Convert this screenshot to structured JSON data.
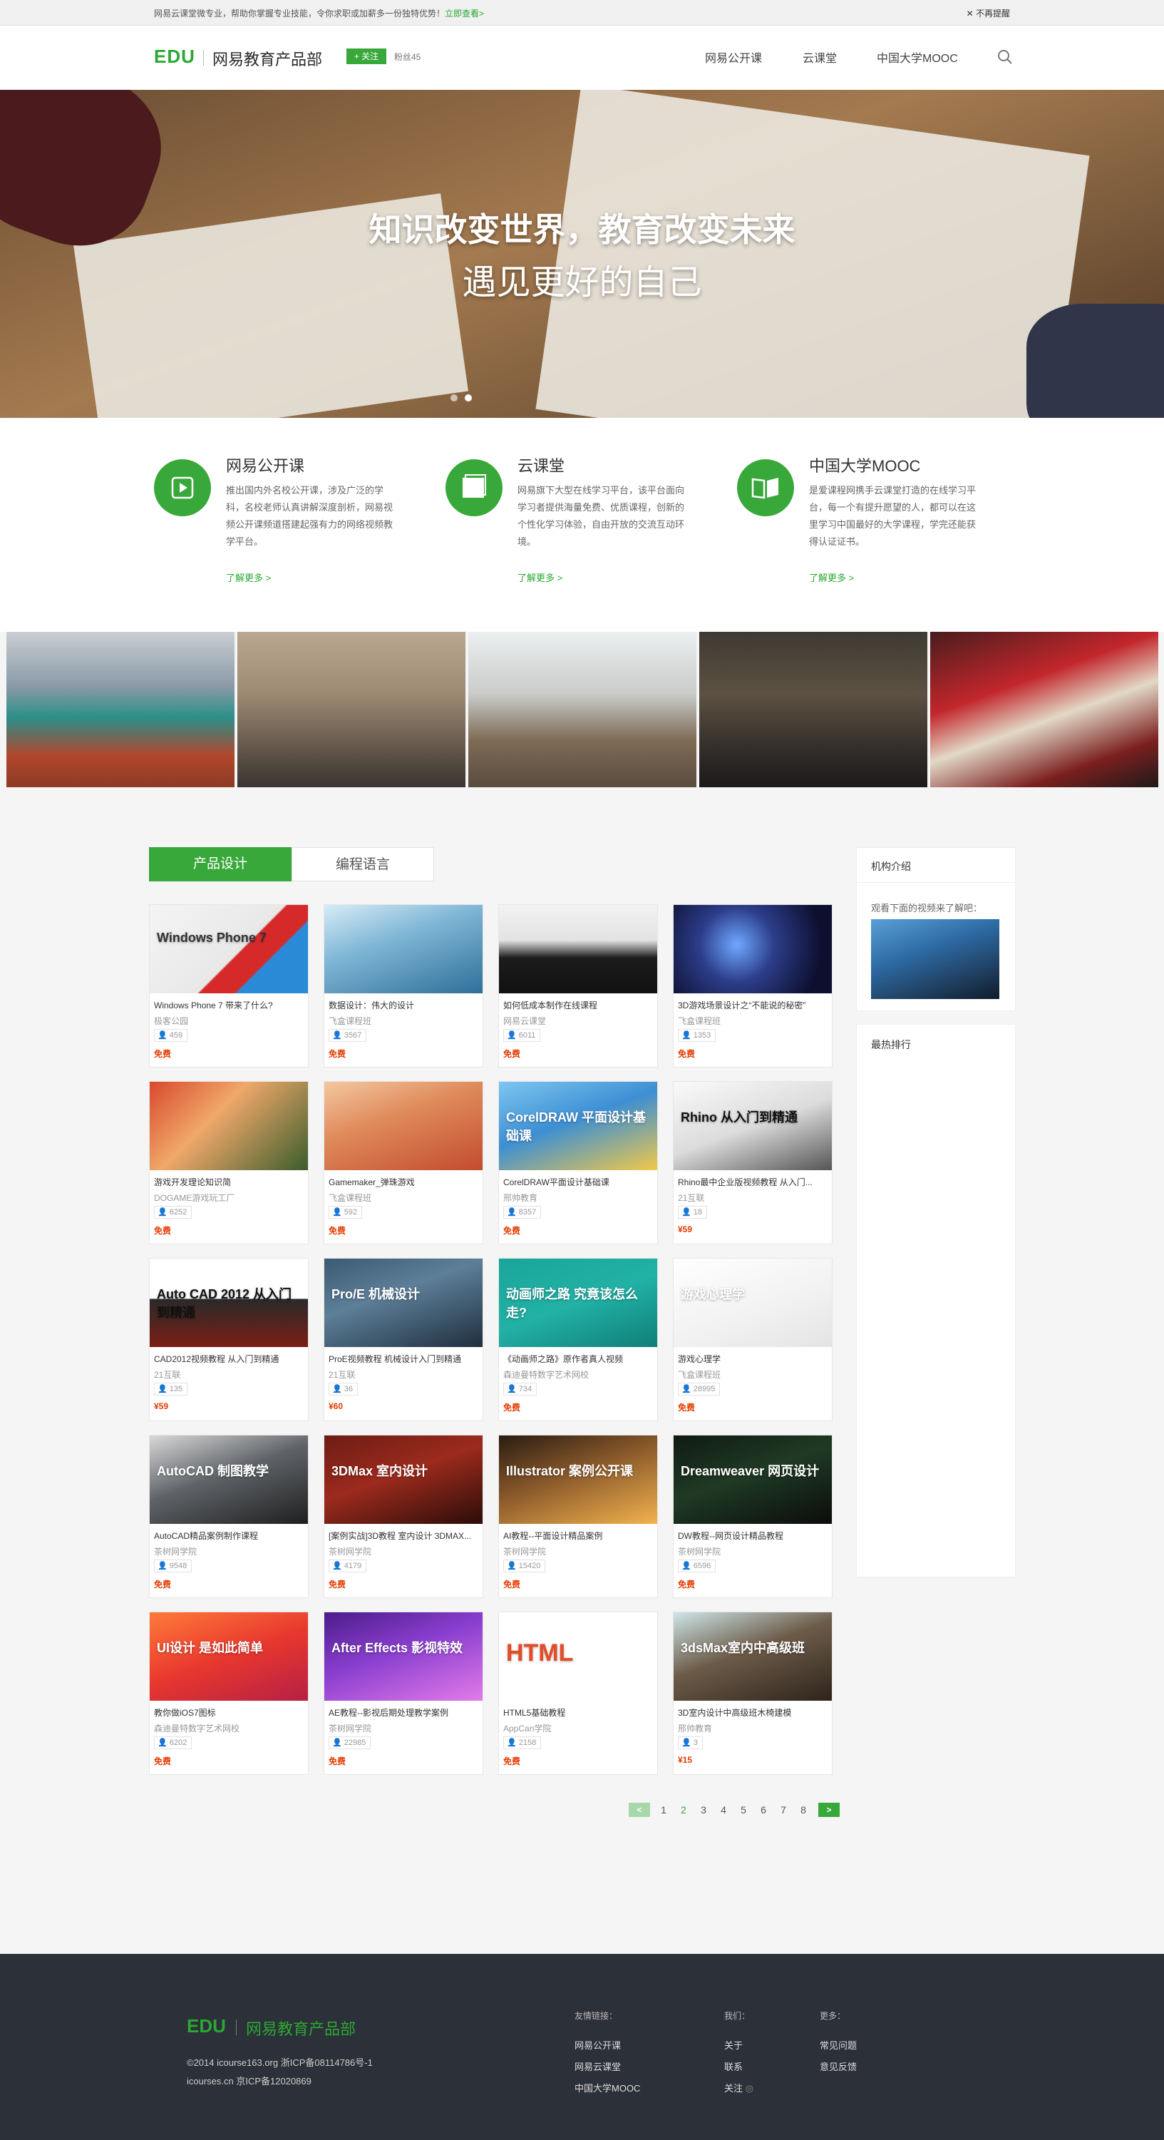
{
  "topbar": {
    "message": "网易云课堂微专业，帮助你掌握专业技能，令你求职或加薪多一份独特优势！",
    "link": "立即查看>",
    "close": "不再提醒"
  },
  "header": {
    "logo": "EDU",
    "org_name": "网易教育产品部",
    "follow_label": "关注",
    "fans": "粉丝45",
    "nav": [
      "网易公开课",
      "云课堂",
      "中国大学MOOC"
    ]
  },
  "banner": {
    "line1": "知识改变世界，教育改变未来",
    "line2": "遇见更好的自己"
  },
  "features": [
    {
      "title": "网易公开课",
      "desc": "推出国内外名校公开课，涉及广泛的学科，名校老师认真讲解深度剖析，网易视频公开课频道搭建起强有力的网络视频教学平台。",
      "more": "了解更多 >"
    },
    {
      "title": "云课堂",
      "desc": "网易旗下大型在线学习平台，该平台面向学习者提供海量免费、优质课程，创新的个性化学习体验，自由开放的交流互动环境。",
      "more": "了解更多 >"
    },
    {
      "title": "中国大学MOOC",
      "desc": "是爱课程网携手云课堂打造的在线学习平台，每一个有提升愿望的人，都可以在这里学习中国最好的大学课程，学完还能获得认证证书。",
      "more": "了解更多 >"
    }
  ],
  "tabs": [
    "产品设计",
    "编程语言"
  ],
  "courses": [
    {
      "title": "Windows Phone 7 带来了什么?",
      "provider": "极客公园",
      "count": "459",
      "price": "免费",
      "cap": "Windows Phone 7"
    },
    {
      "title": "数据设计：伟大的设计",
      "provider": "飞盒课程班",
      "count": "3567",
      "price": "免费",
      "cap": ""
    },
    {
      "title": "如何低成本制作在线课程",
      "provider": "网易云课堂",
      "count": "6011",
      "price": "免费",
      "cap": ""
    },
    {
      "title": "3D游戏场景设计之“不能说的秘密”",
      "provider": "飞盒课程班",
      "count": "1353",
      "price": "免费",
      "cap": ""
    },
    {
      "title": "游戏开发理论知识简",
      "provider": "DOGAME游戏玩工厂",
      "count": "6252",
      "price": "免费",
      "cap": ""
    },
    {
      "title": "Gamemaker_弹珠游戏",
      "provider": "飞盒课程班",
      "count": "592",
      "price": "免费",
      "cap": ""
    },
    {
      "title": "CorelDRAW平面设计基础课",
      "provider": "邢帅教育",
      "count": "8357",
      "price": "免费",
      "cap": "CorelDRAW 平面设计基础课"
    },
    {
      "title": "Rhino最中企业版视频教程 从入门...",
      "provider": "21互联",
      "count": "18",
      "price": "¥59",
      "cap": "Rhino 从入门到精通"
    },
    {
      "title": "CAD2012视频教程 从入门到精通",
      "provider": "21互联",
      "count": "135",
      "price": "¥59",
      "cap": "Auto CAD 2012 从入门到精通"
    },
    {
      "title": "ProE视频教程 机械设计入门到精通",
      "provider": "21互联",
      "count": "36",
      "price": "¥60",
      "cap": "Pro/E 机械设计"
    },
    {
      "title": "《动画师之路》原作者真人视频",
      "provider": "森迪曼特数字艺术网校",
      "count": "734",
      "price": "免费",
      "cap": "动画师之路 究竟该怎么走?"
    },
    {
      "title": "游戏心理学",
      "provider": "飞盒课程班",
      "count": "28995",
      "price": "免费",
      "cap": "游戏心理学"
    },
    {
      "title": "AutoCAD精品案例制作课程",
      "provider": "茶树网学院",
      "count": "9548",
      "price": "免费",
      "cap": "AutoCAD 制图教学"
    },
    {
      "title": "[案例实战]3D教程 室内设计 3DMAX...",
      "provider": "茶树网学院",
      "count": "4179",
      "price": "免费",
      "cap": "3DMax 室内设计"
    },
    {
      "title": "AI教程--平面设计精品案例",
      "provider": "茶树网学院",
      "count": "15420",
      "price": "免费",
      "cap": "Illustrator 案例公开课"
    },
    {
      "title": "DW教程--网页设计精品教程",
      "provider": "茶树网学院",
      "count": "6596",
      "price": "免费",
      "cap": "Dreamweaver 网页设计"
    },
    {
      "title": "教你做iOS7图标",
      "provider": "森迪曼特数字艺术网校",
      "count": "6202",
      "price": "免费",
      "cap": "UI设计 是如此简单"
    },
    {
      "title": "AE教程--影视后期处理教学案例",
      "provider": "茶树网学院",
      "count": "22985",
      "price": "免费",
      "cap": "After Effects 影视特效"
    },
    {
      "title": "HTML5基础教程",
      "provider": "AppCan学院",
      "count": "2158",
      "price": "免费",
      "cap": "HTML"
    },
    {
      "title": "3D室内设计中高级班木椅建模",
      "provider": "邢帅教育",
      "count": "3",
      "price": "¥15",
      "cap": "3dsMax室内中高级班"
    }
  ],
  "sidebar": {
    "intro_title": "机构介绍",
    "intro_text": "观看下面的视频来了解吧：",
    "hot_title": "最热排行"
  },
  "pager": {
    "pages": [
      "1",
      "2",
      "3",
      "4",
      "5",
      "6",
      "7",
      "8"
    ],
    "prev": "<",
    "next": ">",
    "current": "2"
  },
  "footer": {
    "logo": "EDU",
    "org_name": "网易教育产品部",
    "copy1": "©2014 icourse163.org 浙ICP备08114786号-1",
    "copy2": "icourses.cn 京ICP备12020869",
    "links_title": "友情链接：",
    "links": [
      "网易公开课",
      "网易云课堂",
      "中国大学MOOC"
    ],
    "about_title": "我们：",
    "about": [
      "关于",
      "联系",
      "关注"
    ],
    "more_title": "更多：",
    "more": [
      "常见问题",
      "意见反馈"
    ]
  },
  "colors": {
    "accent": "#39a83a",
    "price": "#e43b00",
    "footer_bg": "#2c3038"
  }
}
